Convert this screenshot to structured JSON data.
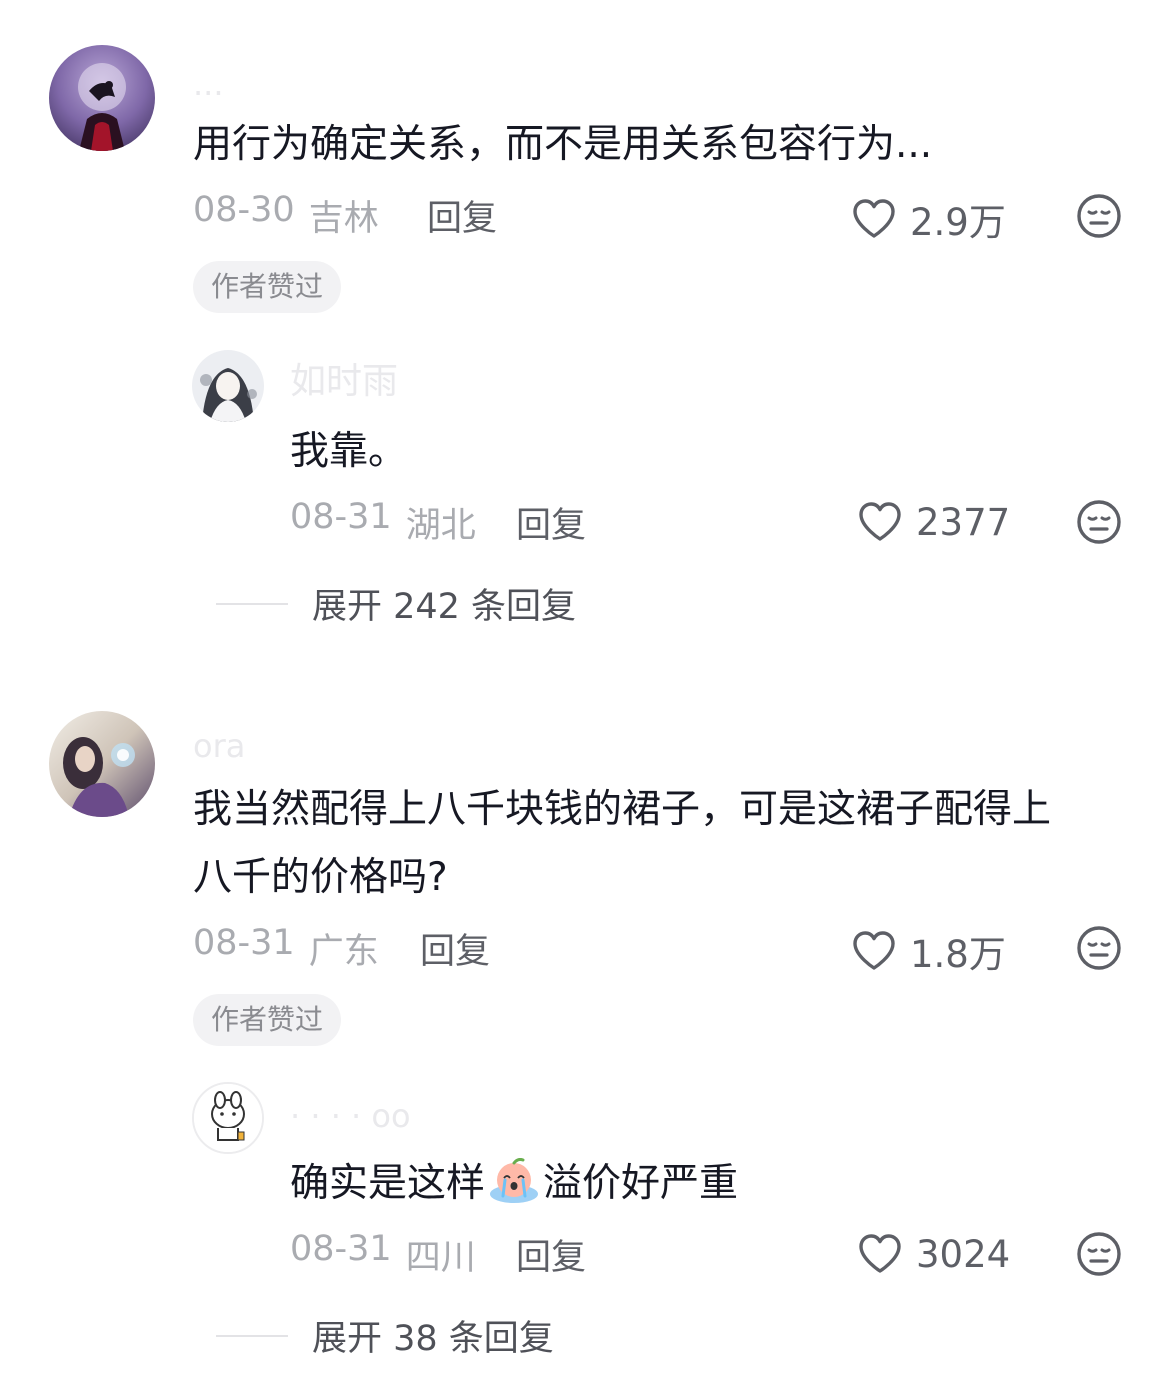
{
  "comments": [
    {
      "username": "...",
      "text": "用行为确定关系，而不是用关系包容行为...",
      "date": "08-30",
      "location": "吉林",
      "reply_label": "回复",
      "likes": "2.9万",
      "badge": "作者赞过",
      "reply": {
        "username": "如时雨",
        "text": "我靠。",
        "date": "08-31",
        "location": "湖北",
        "reply_label": "回复",
        "likes": "2377"
      },
      "expand_label": "展开 242 条回复"
    },
    {
      "username": "ora",
      "text_line1": "我当然配得上八千块钱的裙子，可是这裙子配得上",
      "text_line2": "八千的价格吗?",
      "date": "08-31",
      "location": "广东",
      "reply_label": "回复",
      "likes": "1.8万",
      "badge": "作者赞过",
      "reply": {
        "username": "· · · · oo",
        "text_before_emoji": "确实是这样",
        "emoji": "crying-peach-emoji",
        "text_after_emoji": "溢价好严重",
        "date": "08-31",
        "location": "四川",
        "reply_label": "回复",
        "likes": "3024"
      },
      "expand_label": "展开 38 条回复"
    }
  ],
  "icons": {
    "like": "heart-outline-icon",
    "dislike": "unamused-face-icon"
  },
  "colors": {
    "primary_text": "#161823",
    "secondary_text": "#a9abb0",
    "action_text": "#5d5f66",
    "badge_bg": "#f2f2f4"
  }
}
